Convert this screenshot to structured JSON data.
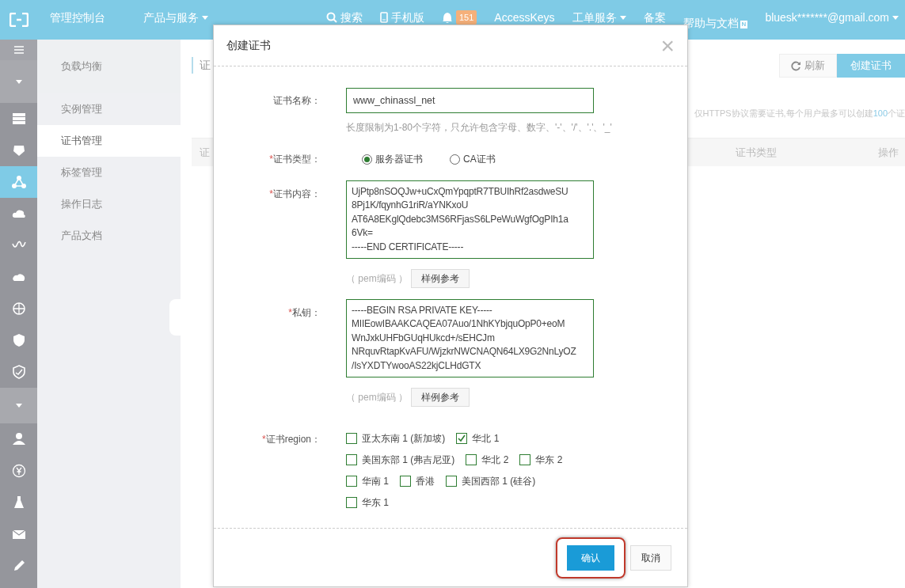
{
  "topbar": {
    "console": "管理控制台",
    "products": "产品与服务",
    "search": "搜索",
    "mobile": "手机版",
    "bell_count": "151",
    "accesskeys": "AccessKeys",
    "tickets": "工单服务",
    "beian": "备案",
    "help": "帮助与文档",
    "help_badge": "N",
    "account": "bluesk*******@gmail.com"
  },
  "rail": [
    {
      "selected": false
    },
    {
      "selected": false
    },
    {
      "selected": true
    },
    {
      "selected": false
    },
    {
      "selected": false
    },
    {
      "selected": false
    },
    {
      "selected": false
    },
    {
      "selected": false
    },
    {
      "selected": false
    },
    {
      "selected": false
    },
    {
      "selected": false
    },
    {
      "selected": false
    },
    {
      "selected": false
    },
    {
      "selected": false
    }
  ],
  "sidebar": {
    "title": "负载均衡",
    "items": [
      {
        "label": "实例管理",
        "selected": false
      },
      {
        "label": "证书管理",
        "selected": true
      },
      {
        "label": "标签管理",
        "selected": false
      },
      {
        "label": "操作日志",
        "selected": false
      },
      {
        "label": "产品文档",
        "selected": false
      }
    ]
  },
  "page": {
    "title": "证",
    "refresh": "刷新",
    "create": "创建证书",
    "notice_prefix": "仅HTTPS协议需要证书,每个用户最多可以创建",
    "notice_count": "100",
    "notice_suffix": "个证",
    "columns": [
      "证",
      "证书类型",
      "操作"
    ]
  },
  "dialog": {
    "title": "创建证书",
    "close": "×",
    "name_label": "证书名称：",
    "name_value": "www_chinassl_net",
    "name_hint": "长度限制为1-80个字符，只允许包含字母、数字、'-'、'/'、'.'、'_'",
    "type_mark": "*",
    "type_label": "证书类型：",
    "types": [
      {
        "label": "服务器证书",
        "selected": true
      },
      {
        "label": "CA证书",
        "selected": false
      }
    ],
    "content_mark": "*",
    "content_label": "证书内容：",
    "content_value": "UjPtp8nSOQJw+uCxQmYpqptR7TBUIhRf2asdweSU\n8Pj1K/fqynhG1riR/aYNKxoU\nAT6A8EKglQdebc3MS6RFjasS6LPeWuWgfOgPIh1a\n6Vk=\n-----END CERTIFICATE-----",
    "content_encoding": "（ pem编码 ）",
    "content_sample": "样例参考",
    "key_mark": "*",
    "key_label": "私钥：",
    "key_value": "-----BEGIN RSA PRIVATE KEY-----\nMIIEowIBAAKCAQEA07Auo/1NhKYbjquOpP0+eoM\nWnJxkUHFbGUqHUkcd+/sEHCJm\nNRquvRtapKvAFU/WjzkrNWCNAQN64LX9G2NnLyOZ\n/IsYXDTYwooAS22kjCLHdGTX",
    "key_encoding": "（ pem编码 ）",
    "key_sample": "样例参考",
    "region_mark": "*",
    "region_label": "证书region：",
    "regions": [
      [
        {
          "label": "亚太东南 1 (新加坡)",
          "checked": false
        },
        {
          "label": "华北 1",
          "checked": true
        }
      ],
      [
        {
          "label": "美国东部 1 (弗吉尼亚)",
          "checked": false
        },
        {
          "label": "华北 2",
          "checked": false
        },
        {
          "label": "华东 2",
          "checked": false
        }
      ],
      [
        {
          "label": "华南 1",
          "checked": false
        },
        {
          "label": "香港",
          "checked": false
        },
        {
          "label": "美国西部 1 (硅谷)",
          "checked": false
        }
      ],
      [
        {
          "label": "华东 1",
          "checked": false
        }
      ]
    ],
    "ok": "确认",
    "ok_highlighted": true,
    "cancel": "取消"
  }
}
